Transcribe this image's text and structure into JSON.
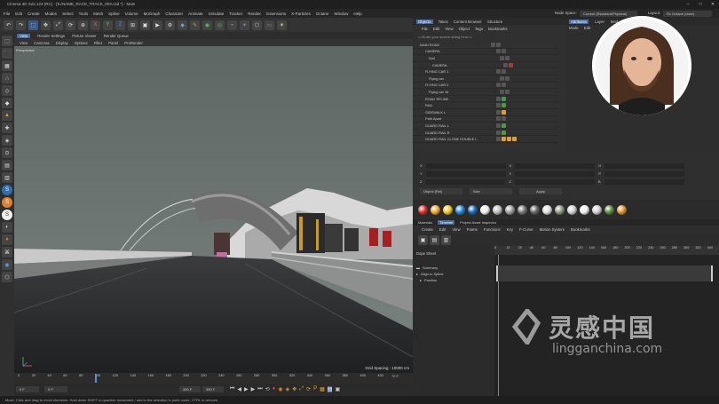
{
  "window": {
    "title": "Cinema 4D S22.123 (RC) - [S√NAME_RACE_TRACK_003.c4d *] - Main",
    "controls": [
      "–",
      "□",
      "✕"
    ]
  },
  "menubar": {
    "items": [
      "File",
      "Edit",
      "Create",
      "Modes",
      "Select",
      "Tools",
      "Mesh",
      "Spline",
      "Volume",
      "MoGraph",
      "Character",
      "Animate",
      "Simulate",
      "Tracker",
      "Render",
      "Extensions",
      "X-Particles",
      "Octane",
      "Window",
      "Help"
    ]
  },
  "layoutbar": {
    "node_space_label": "Node Space:",
    "node_space_value": "Current (Standard/Physical)",
    "layout_label": "Layout:",
    "layout_value": "Rx Octane (User)"
  },
  "viewport": {
    "tabs": [
      "View",
      "Render Settings",
      "Picture Viewer",
      "Render Queue"
    ],
    "menu": [
      "View",
      "Cameras",
      "Display",
      "Options",
      "Filter",
      "Panel",
      "ProRender"
    ],
    "label": "Perspective",
    "grid_spacing": "Grid Spacing : 10000 cm"
  },
  "timeline": {
    "ruler": [
      "0",
      "20",
      "40",
      "60",
      "80",
      "100",
      "120",
      "140",
      "160",
      "180",
      "200",
      "220",
      "240",
      "260",
      "280",
      "300",
      "320",
      "340",
      "360",
      "380",
      "400",
      "420"
    ],
    "current_frame": "72 F",
    "start_field": "0 F",
    "min_field": "0 F",
    "end_field": "350 F",
    "max_field": "350 F"
  },
  "status": {
    "text": "Move: Click and drag to move elements. Hold down SHIFT to quantize movement / add to the selection in point mode, CTRL to remove."
  },
  "objects": {
    "tabs": [
      "Objects",
      "Takes",
      "Content Browser",
      "Structure"
    ],
    "menu": [
      "File",
      "Edit",
      "View",
      "Object",
      "Tags",
      "Bookmarks"
    ],
    "search_placeholder": "<<Enter your search string here>>",
    "rows": [
      {
        "label": "MAIN ROAD"
      },
      {
        "label": "CAMERA"
      },
      {
        "label": "Null"
      },
      {
        "label": "CAMERA"
      },
      {
        "label": "FLYING CAR 1"
      },
      {
        "label": "Flying car"
      },
      {
        "label": "FLYING CAR 2"
      },
      {
        "label": "Flying car 16"
      },
      {
        "label": "ROAD SPLINE"
      },
      {
        "label": "RAIL"
      },
      {
        "label": "SIDEWALK L"
      },
      {
        "label": "Path Apart"
      },
      {
        "label": "GUARD RAIL L"
      },
      {
        "label": "GUARD RAIL R"
      },
      {
        "label": "GUARD RAIL CLONE DOUBLE L"
      }
    ]
  },
  "attributes": {
    "tabs": [
      "Attributes",
      "Layer",
      "Mod"
    ],
    "menu": [
      "Mode",
      "Edit"
    ]
  },
  "coordinates": {
    "rows": [
      {
        "a": "X",
        "b": "X",
        "c": "H"
      },
      {
        "a": "Y",
        "b": "Y",
        "c": "P"
      },
      {
        "a": "Z",
        "b": "Z",
        "c": "B"
      }
    ],
    "object_mode": "Object (Rel)",
    "size_mode": "Size",
    "apply": "Apply"
  },
  "materials_colors": [
    "#e02828",
    "#f5a623",
    "#f0c419",
    "#1e88e5",
    "#1565c0",
    "#eeeeee",
    "#bdbdbd",
    "#9e9e9e",
    "#757575",
    "#616161",
    "#e0e0e0",
    "#8a9a7a",
    "#d0d0d0",
    "#efefef",
    "#cfcfcf",
    "#5a8a3a",
    "#e09020"
  ],
  "timeline_panel": {
    "tabs": [
      "Materials",
      "Timeline",
      "Project Asset Inspector"
    ],
    "menu": [
      "Create",
      "Edit",
      "View",
      "Frame",
      "Functions",
      "Key",
      "F-Curve",
      "Motion System",
      "Bookmarks"
    ],
    "ruler": [
      "0",
      "10",
      "20",
      "40",
      "60",
      "80",
      "100",
      "120",
      "140",
      "160",
      "180",
      "200",
      "220",
      "240",
      "260",
      "280",
      "300",
      "320",
      "340"
    ],
    "header": "Dope Sheet",
    "tracks": [
      "Summary",
      "Align to Spline",
      "Position"
    ]
  },
  "watermark": {
    "text": "灵感中国",
    "url": "lingganchina.com"
  }
}
